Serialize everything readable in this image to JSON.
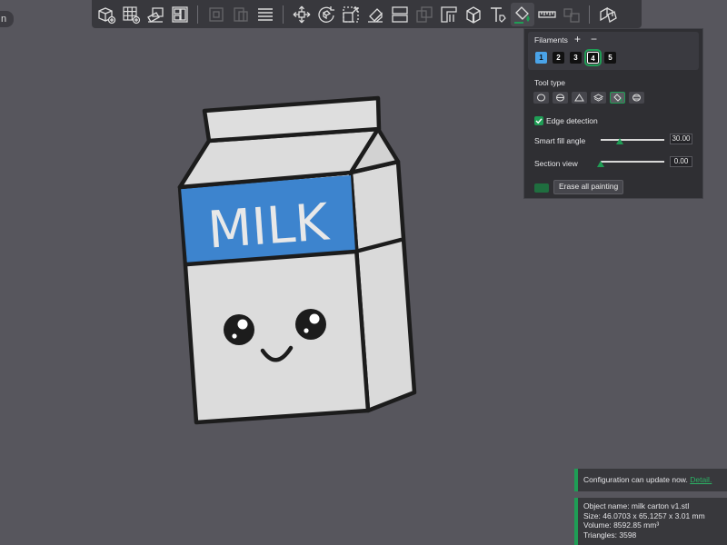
{
  "corner": {
    "label": "n"
  },
  "toolbar": {
    "buttons": [
      {
        "name": "add-object-icon",
        "enabled": true
      },
      {
        "name": "add-plate-icon",
        "enabled": true
      },
      {
        "name": "orient-icon",
        "enabled": true
      },
      {
        "name": "arrange-icon",
        "enabled": true
      },
      {
        "name": "split-objects-icon",
        "enabled": false
      },
      {
        "name": "split-parts-icon",
        "enabled": false
      },
      {
        "name": "layers-editing-icon",
        "enabled": true
      },
      {
        "name": "move-icon",
        "enabled": true
      },
      {
        "name": "rotate-icon",
        "enabled": true
      },
      {
        "name": "scale-icon",
        "enabled": true
      },
      {
        "name": "lay-on-face-icon",
        "enabled": true
      },
      {
        "name": "cut-icon",
        "enabled": true
      },
      {
        "name": "boolean-icon",
        "enabled": false
      },
      {
        "name": "support-painting-icon",
        "enabled": true
      },
      {
        "name": "seam-painting-icon",
        "enabled": true
      },
      {
        "name": "text-shape-icon",
        "enabled": true
      },
      {
        "name": "color-painting-icon",
        "enabled": true
      },
      {
        "name": "measure-icon",
        "enabled": true
      },
      {
        "name": "assembly-icon",
        "enabled": false
      },
      {
        "name": "assembly-view-icon",
        "enabled": true
      }
    ]
  },
  "model": {
    "label": "MILK",
    "colors": {
      "body": "#dcdcdc",
      "label_band": "#3d84ce",
      "outline": "#1c1c1c",
      "text": "#e8e8e8"
    }
  },
  "panel": {
    "filaments_title": "Filaments",
    "add_symbol": "+",
    "remove_symbol": "−",
    "filaments": [
      {
        "label": "1",
        "color": "#4aa3e8",
        "selected": false
      },
      {
        "label": "2",
        "color": "#111111",
        "selected": false
      },
      {
        "label": "3",
        "color": "#111111",
        "selected": false
      },
      {
        "label": "4",
        "color": "#111111",
        "selected": true
      },
      {
        "label": "5",
        "color": "#111111",
        "selected": false
      }
    ],
    "tool_type_label": "Tool type",
    "tools": [
      {
        "name": "circle-tool-icon",
        "active": false
      },
      {
        "name": "sphere-tool-icon",
        "active": false
      },
      {
        "name": "triangle-tool-icon",
        "active": false
      },
      {
        "name": "height-range-tool-icon",
        "active": false
      },
      {
        "name": "fill-tool-icon",
        "active": true
      },
      {
        "name": "gap-fill-tool-icon",
        "active": false
      }
    ],
    "edge_detection": {
      "label": "Edge detection",
      "checked": true
    },
    "smart_fill_angle": {
      "label": "Smart fill angle",
      "value": "30.00",
      "fraction": 0.3
    },
    "section_view": {
      "label": "Section view",
      "value": "0.00",
      "fraction": 0.0
    },
    "erase_all_label": "Erase all painting",
    "accent_color": "#1f9d55"
  },
  "notifications": {
    "update": {
      "text": "Configuration can update now.",
      "link": "Detail."
    },
    "object_info": {
      "name": "Object name: milk carton v1.stl",
      "size": "Size: 46.0703 x 65.1257 x 3.01 mm",
      "volume": "Volume: 8592.85 mm³",
      "triangles": "Triangles: 3598"
    }
  }
}
